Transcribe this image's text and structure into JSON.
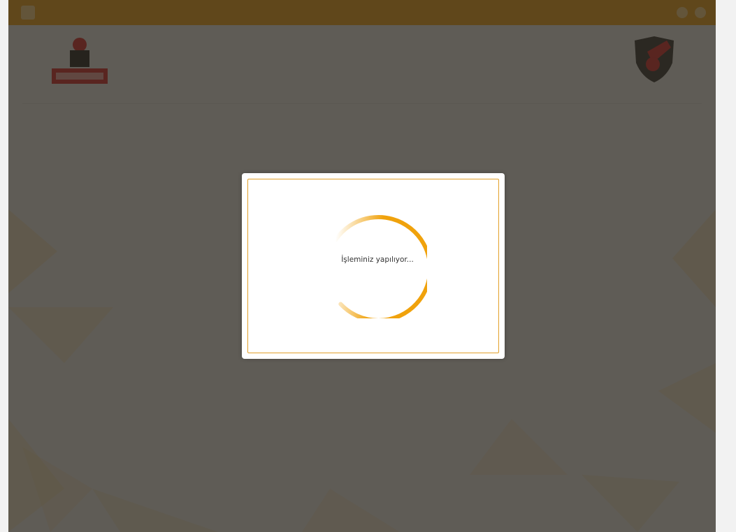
{
  "colors": {
    "accent": "#f1a21b",
    "overlay": "rgba(40,36,28,0.72)",
    "modal_border": "#e2a02a",
    "spinner": "#f0a20c"
  },
  "topbar": {
    "home_icon": "home-icon",
    "right_icons": [
      "user-icon",
      "power-icon"
    ]
  },
  "header": {
    "title": "",
    "subtitle": ""
  },
  "modal": {
    "message": "İşleminiz yapılıyor...",
    "spinner_icon": "loading-spinner-icon"
  }
}
